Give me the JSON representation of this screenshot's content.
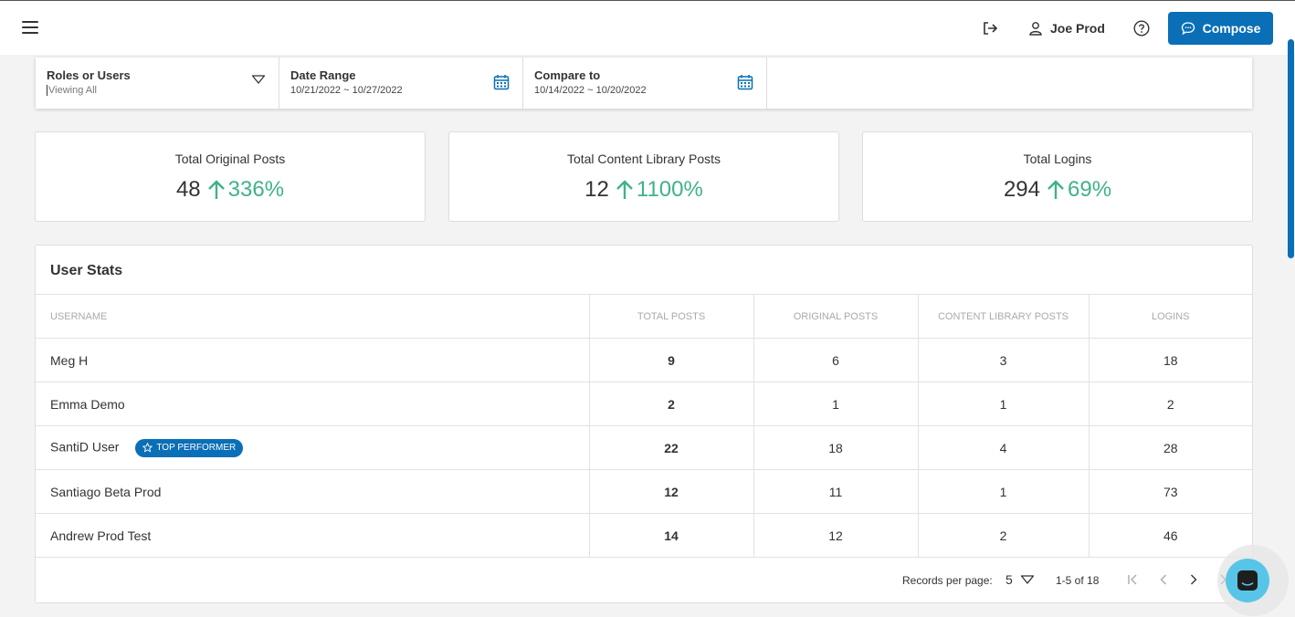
{
  "header": {
    "user_name": "Joe Prod",
    "compose_label": "Compose"
  },
  "filters": [
    {
      "title": "Roles or Users",
      "value": "Viewing All"
    },
    {
      "title": "Date Range",
      "value": "10/21/2022 ~ 10/27/2022"
    },
    {
      "title": "Compare to",
      "value": "10/14/2022 ~ 10/20/2022"
    }
  ],
  "cards": [
    {
      "title": "Total Original Posts",
      "value": "48",
      "change": "336%"
    },
    {
      "title": "Total Content Library Posts",
      "value": "12",
      "change": "1100%"
    },
    {
      "title": "Total Logins",
      "value": "294",
      "change": "69%"
    }
  ],
  "user_stats": {
    "title": "User Stats",
    "columns": [
      "USERNAME",
      "TOTAL POSTS",
      "ORIGINAL POSTS",
      "CONTENT LIBRARY POSTS",
      "LOGINS"
    ],
    "badge_label": "TOP PERFORMER",
    "rows": [
      {
        "username": "Meg H",
        "total": "9",
        "original": "6",
        "library": "3",
        "logins": "18"
      },
      {
        "username": "Emma Demo",
        "total": "2",
        "original": "1",
        "library": "1",
        "logins": "2"
      },
      {
        "username": "SantiD User",
        "total": "22",
        "original": "18",
        "library": "4",
        "logins": "28"
      },
      {
        "username": "Santiago Beta Prod",
        "total": "12",
        "original": "11",
        "library": "1",
        "logins": "73"
      },
      {
        "username": "Andrew Prod Test",
        "total": "14",
        "original": "12",
        "library": "2",
        "logins": "46"
      }
    ],
    "pagination": {
      "records_per_page_label": "Records per page:",
      "records_per_page": "5",
      "range": "1-5 of 18"
    }
  },
  "colors": {
    "accent": "#0a6fb6",
    "positive": "#3fb28a",
    "chat": "#58c5e8"
  },
  "icons": [
    "menu-icon",
    "logout-icon",
    "user-icon",
    "help-icon",
    "chat-bubble-icon",
    "chevron-down-icon",
    "calendar-icon",
    "arrow-up-icon",
    "star-icon",
    "first-page-icon",
    "prev-page-icon",
    "next-page-icon",
    "last-page-icon",
    "chat-icon"
  ]
}
